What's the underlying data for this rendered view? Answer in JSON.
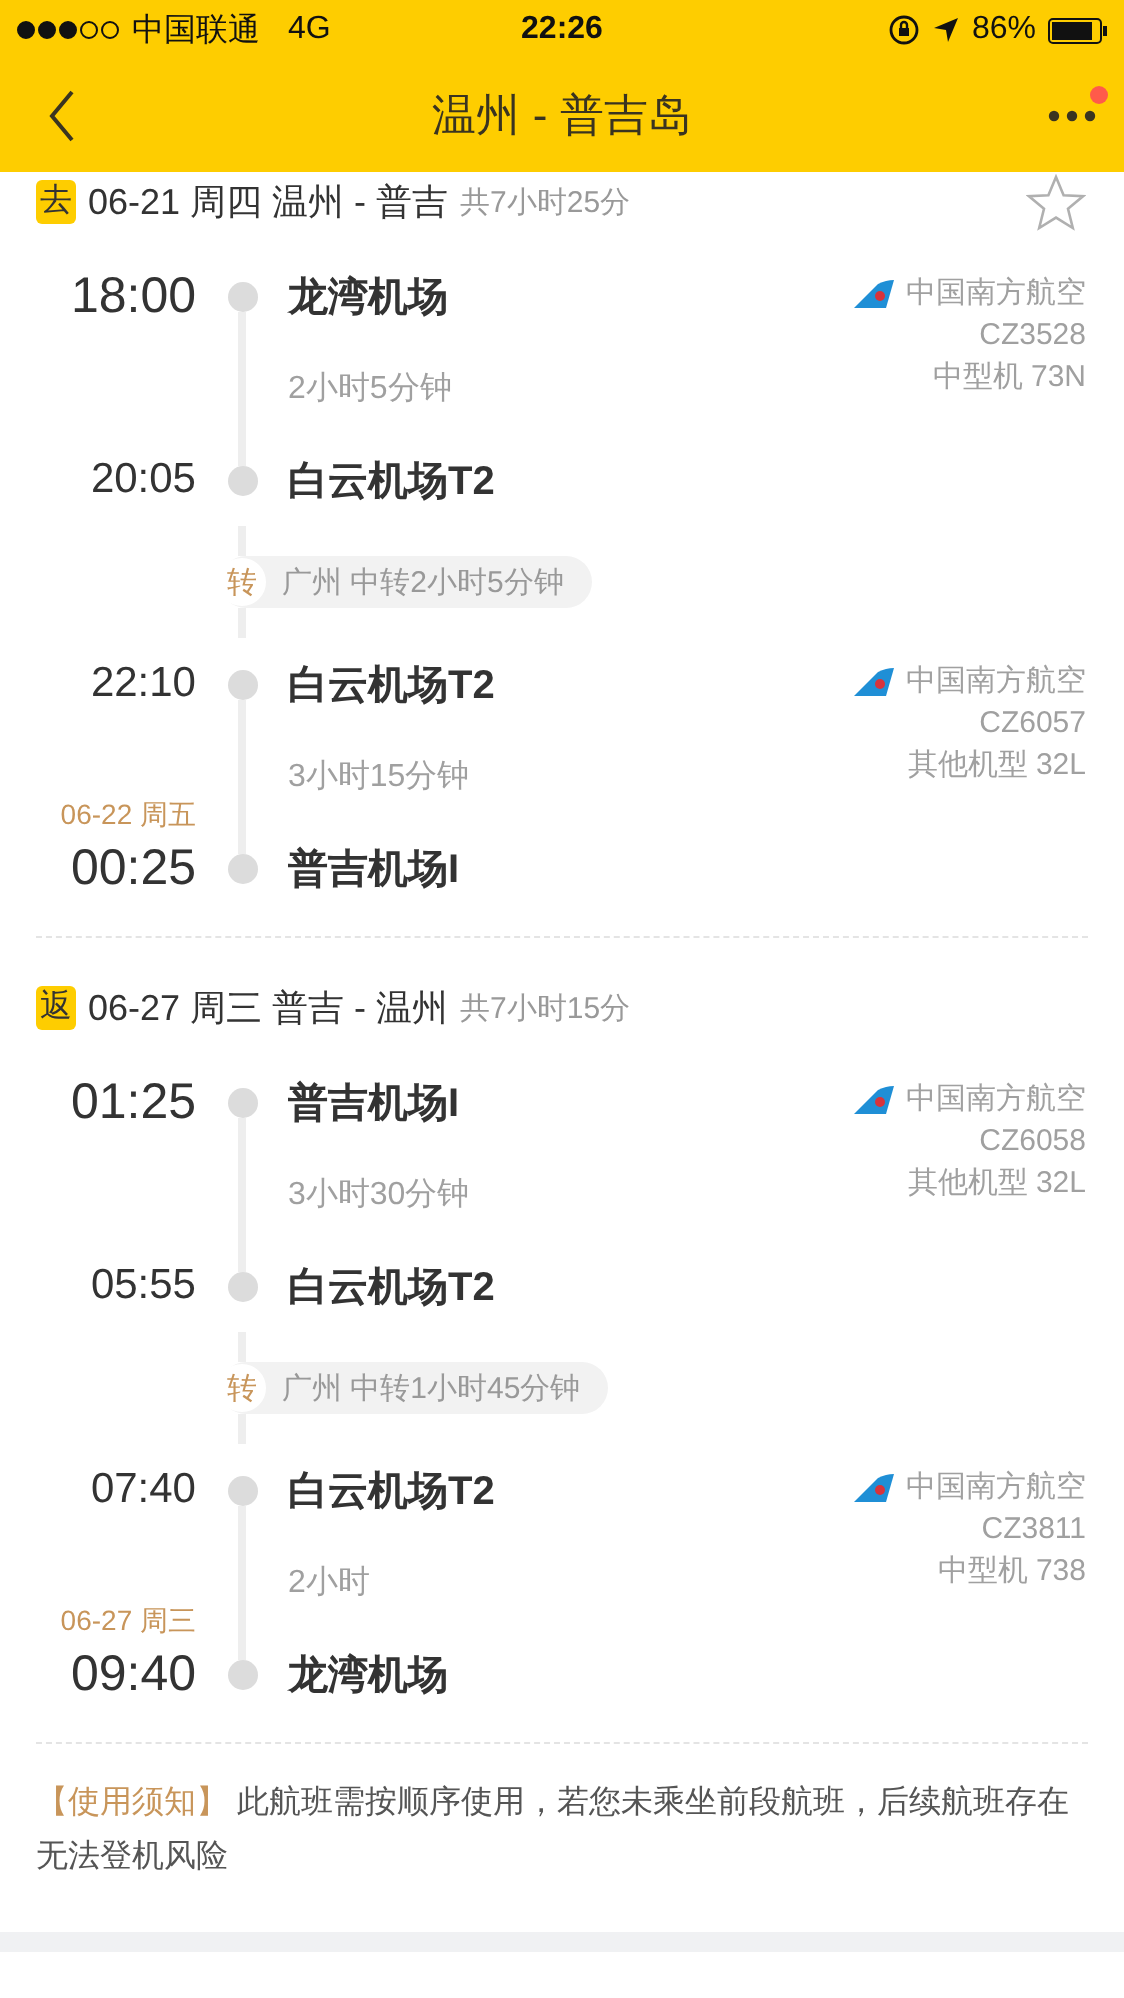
{
  "status_bar": {
    "carrier": "中国联通",
    "network": "4G",
    "time": "22:26",
    "battery": "86%"
  },
  "nav": {
    "title": "温州 - 普吉岛",
    "has_badge": true
  },
  "trips": [
    {
      "badge": "去",
      "heading": "06-21 周四 温州 - 普吉",
      "total": "共7小时25分",
      "star": {
        "on": false
      },
      "legs": [
        {
          "kind": "flight",
          "departure": {
            "time": "18:00",
            "airport": "龙湾机场",
            "prominent": true
          },
          "duration": "2小时5分钟",
          "arrival": {
            "time": "20:05",
            "airport": "白云机场T2",
            "prominent": false
          },
          "airline": {
            "name": "中国南方航空",
            "flight_no": "CZ3528",
            "aircraft": "中型机 73N"
          }
        },
        {
          "kind": "transfer",
          "badge": "转",
          "text": "广州 中转2小时5分钟"
        },
        {
          "kind": "flight",
          "departure": {
            "time": "22:10",
            "airport": "白云机场T2",
            "prominent": false
          },
          "duration": "3小时15分钟",
          "arrival": {
            "date": "06-22 周五",
            "time": "00:25",
            "airport": "普吉机场I",
            "prominent": true
          },
          "airline": {
            "name": "中国南方航空",
            "flight_no": "CZ6057",
            "aircraft": "其他机型 32L"
          }
        }
      ]
    },
    {
      "badge": "返",
      "heading": "06-27 周三 普吉 - 温州",
      "total": "共7小时15分",
      "legs": [
        {
          "kind": "flight",
          "departure": {
            "time": "01:25",
            "airport": "普吉机场I",
            "prominent": true
          },
          "duration": "3小时30分钟",
          "arrival": {
            "time": "05:55",
            "airport": "白云机场T2",
            "prominent": false
          },
          "airline": {
            "name": "中国南方航空",
            "flight_no": "CZ6058",
            "aircraft": "其他机型 32L"
          }
        },
        {
          "kind": "transfer",
          "badge": "转",
          "text": "广州 中转1小时45分钟"
        },
        {
          "kind": "flight",
          "departure": {
            "time": "07:40",
            "airport": "白云机场T2",
            "prominent": false
          },
          "duration": "2小时",
          "arrival": {
            "date": "06-27 周三",
            "time": "09:40",
            "airport": "龙湾机场",
            "prominent": true
          },
          "airline": {
            "name": "中国南方航空",
            "flight_no": "CZ3811",
            "aircraft": "中型机 738"
          }
        }
      ]
    }
  ],
  "notice": {
    "label": "【使用须知】",
    "text": "此航班需按顺序使用，若您未乘坐前段航班，后续航班存在无法登机风险"
  }
}
